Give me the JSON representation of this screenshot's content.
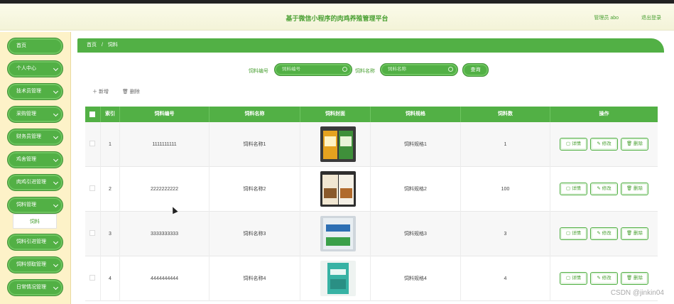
{
  "header": {
    "title": "基于微信小程序的肉鸡养殖管理平台",
    "user": "管理员 abo",
    "logout": "退出登录"
  },
  "sidebar": {
    "items": [
      {
        "label": "首页",
        "chevron": false
      },
      {
        "label": "个人中心",
        "chevron": true
      },
      {
        "label": "技术员管理",
        "chevron": true
      },
      {
        "label": "采购管理",
        "chevron": true
      },
      {
        "label": "财务员管理",
        "chevron": true
      },
      {
        "label": "鸡舍管理",
        "chevron": true
      },
      {
        "label": "肉鸡引进管理",
        "chevron": true
      },
      {
        "label": "饲料管理",
        "chevron": true
      },
      {
        "label": "饲料引进管理",
        "chevron": true
      },
      {
        "label": "饲料领取管理",
        "chevron": true
      },
      {
        "label": "日常情况管理",
        "chevron": true
      }
    ],
    "active_sub": "饲料"
  },
  "breadcrumb": [
    "首页",
    "/",
    "饲料"
  ],
  "search": {
    "field1_label": "饲料编号",
    "field1_placeholder": "饲料编号",
    "field2_label": "饲料名称",
    "field2_placeholder": "饲料名称",
    "query_label": "查询"
  },
  "toolbar": {
    "add_label": "＋ 新增",
    "delete_label": "🗑 删除"
  },
  "table": {
    "headers": [
      "索引",
      "饲料编号",
      "饲料名称",
      "饲料封面",
      "饲料规格",
      "饲料数",
      "操作"
    ],
    "rows": [
      {
        "index": "1",
        "code": "1111111111",
        "name": "饲料名称1",
        "spec": "饲料规格1",
        "count": "1"
      },
      {
        "index": "2",
        "code": "2222222222",
        "name": "饲料名称2",
        "spec": "饲料规格2",
        "count": "100"
      },
      {
        "index": "3",
        "code": "3333333333",
        "name": "饲料名称3",
        "spec": "饲料规格3",
        "count": "3"
      },
      {
        "index": "4",
        "code": "4444444444",
        "name": "饲料名称4",
        "spec": "饲料规格4",
        "count": "4"
      }
    ],
    "actions": [
      "详情",
      "修改",
      "删除"
    ]
  },
  "watermark": "CSDN @jinkin04",
  "colors": {
    "accent": "#52b045",
    "sidebar_bg": "#fdf2c8",
    "header_bg": "#f8f8e2"
  }
}
